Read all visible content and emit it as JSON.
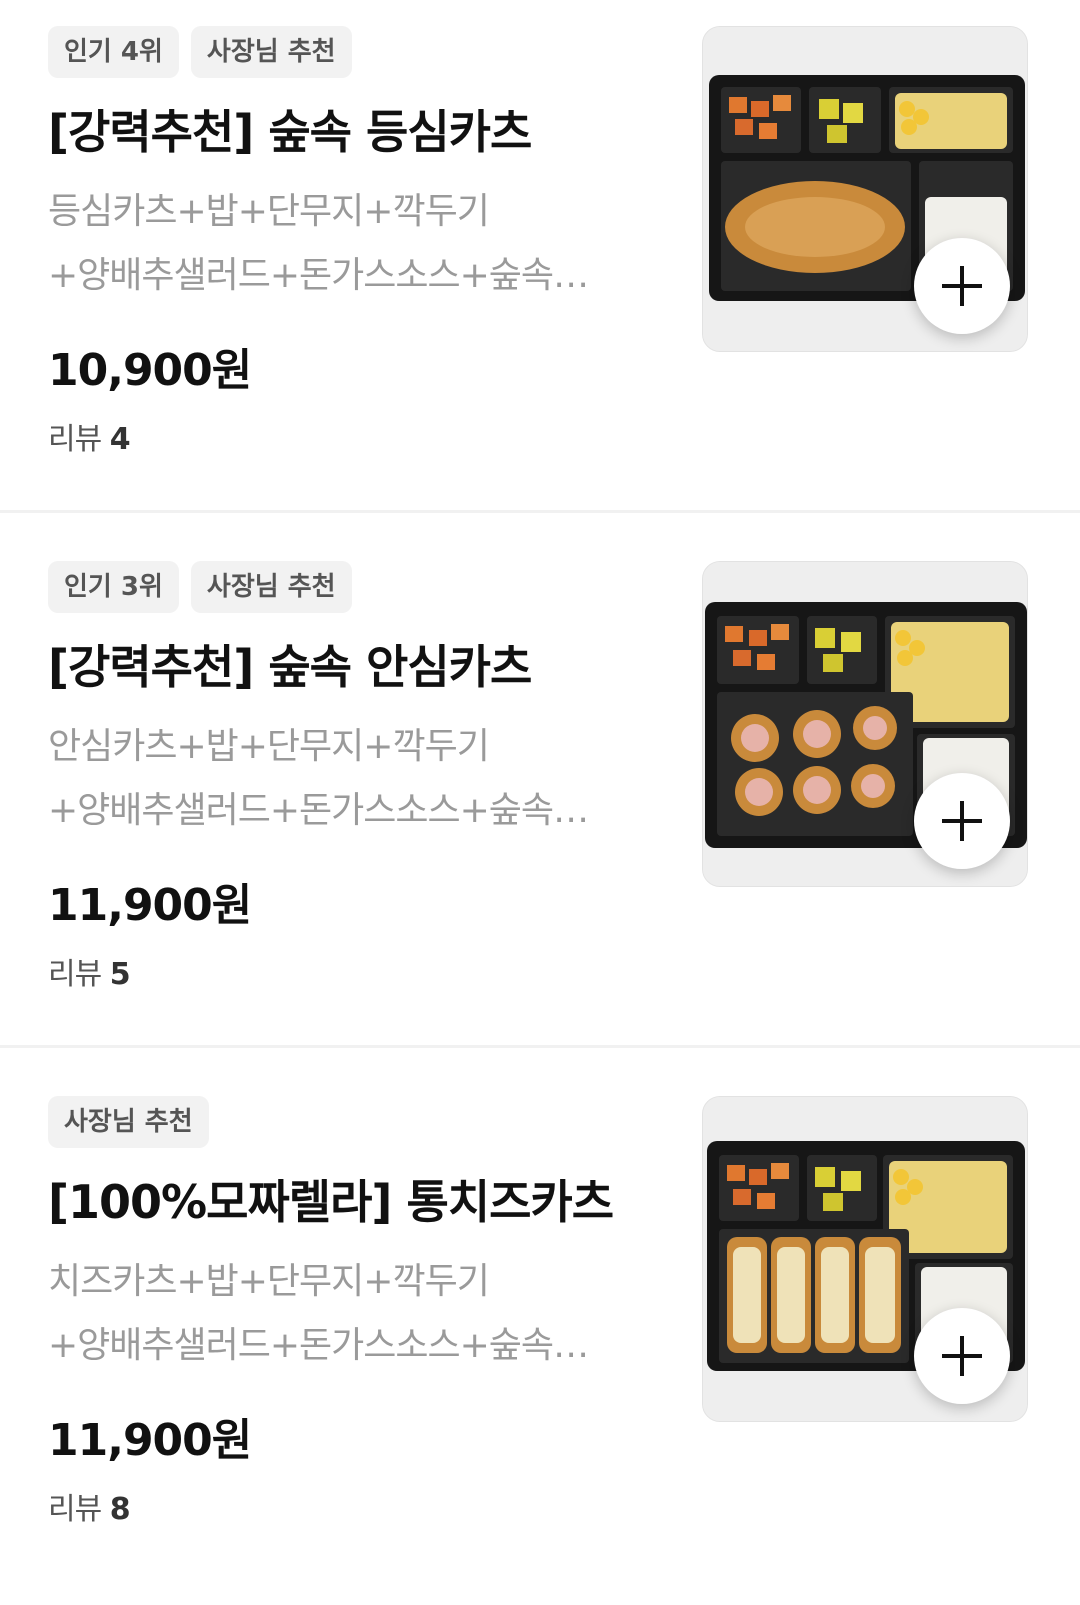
{
  "menu": {
    "items": [
      {
        "badges": [
          "인기 4위",
          "사장님 추천"
        ],
        "title": "[강력추천] 숲속 등심카츠",
        "description": "등심카츠+밥+단무지+깍두기+양배추샐러드+돈가스소스+숲속 시그니처소스",
        "price": "10,900원",
        "review_label": "리뷰",
        "review_count": "4",
        "image_icon": "food-photo-icon",
        "add_icon": "plus-icon"
      },
      {
        "badges": [
          "인기 3위",
          "사장님 추천"
        ],
        "title": "[강력추천] 숲속 안심카츠",
        "description": "안심카츠+밥+단무지+깍두기+양배추샐러드+돈가스소스+숲속 시그니처소스",
        "price": "11,900원",
        "review_label": "리뷰",
        "review_count": "5",
        "image_icon": "food-photo-icon",
        "add_icon": "plus-icon"
      },
      {
        "badges": [
          "사장님 추천"
        ],
        "title": "[100%모짜렐라] 통치즈카츠",
        "description": "치즈카츠+밥+단무지+깍두기+양배추샐러드+돈가스소스+숲속 시그니처소스",
        "price": "11,900원",
        "review_label": "리뷰",
        "review_count": "8",
        "image_icon": "food-photo-icon",
        "add_icon": "plus-icon"
      }
    ]
  },
  "colors": {
    "badge_bg": "#f2f2f2",
    "badge_text": "#555555",
    "title": "#111111",
    "description": "#9a9a9a",
    "divider": "#f1f1f1"
  }
}
